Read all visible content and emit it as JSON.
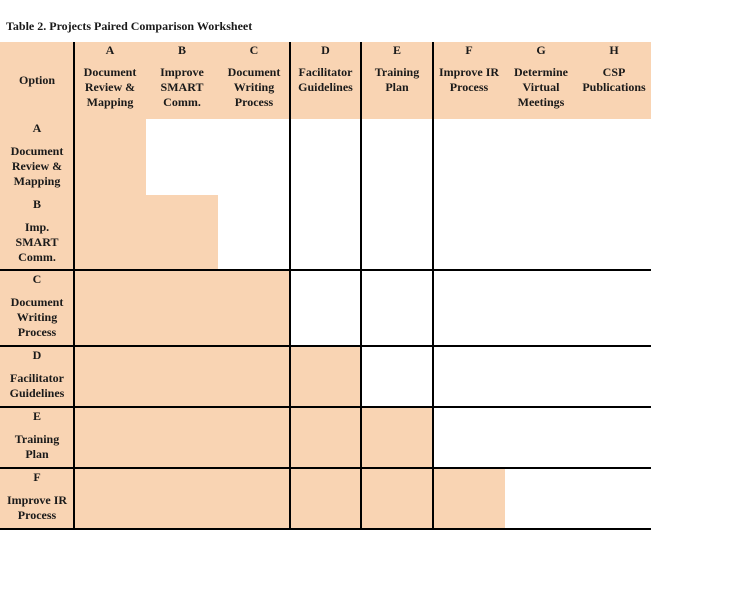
{
  "caption": "Table 2. Projects Paired Comparison Worksheet",
  "colors": {
    "highlight": "#F9D4B3",
    "line": "#000000"
  },
  "header": {
    "option_label": "Option",
    "columns": [
      {
        "letter": "A",
        "name": "Document Review & Mapping",
        "lines": [
          "Document",
          "Review &",
          "Mapping"
        ]
      },
      {
        "letter": "B",
        "name": "Improve SMART Comm.",
        "lines": [
          "Improve",
          "SMART",
          "Comm."
        ]
      },
      {
        "letter": "C",
        "name": "Document Writing Process",
        "lines": [
          "Document",
          "Writing",
          "Process"
        ]
      },
      {
        "letter": "D",
        "name": "Facilitator Guidelines",
        "lines": [
          "Facilitator",
          "Guidelines"
        ]
      },
      {
        "letter": "E",
        "name": "Training Plan",
        "lines": [
          "Training",
          "Plan"
        ]
      },
      {
        "letter": "F",
        "name": "Improve IR Process",
        "lines": [
          "Improve IR",
          "Process"
        ]
      },
      {
        "letter": "G",
        "name": "Determine Virtual Meetings",
        "lines": [
          "Determine",
          "Virtual",
          "Meetings"
        ]
      },
      {
        "letter": "H",
        "name": "CSP Publications",
        "lines": [
          "CSP",
          "Publications"
        ]
      }
    ]
  },
  "rows": [
    {
      "letter": "A",
      "lines": [
        "Document",
        "Review &",
        "Mapping"
      ],
      "shaded_through": 1,
      "cells": [
        "",
        "",
        "",
        "",
        "",
        "",
        "",
        ""
      ]
    },
    {
      "letter": "B",
      "lines": [
        "Imp.",
        "SMART",
        "Comm."
      ],
      "shaded_through": 2,
      "cells": [
        "",
        "",
        "",
        "",
        "",
        "",
        "",
        ""
      ]
    },
    {
      "letter": "C",
      "lines": [
        "Document",
        "Writing",
        "Process"
      ],
      "shaded_through": 3,
      "cells": [
        "",
        "",
        "",
        "",
        "",
        "",
        "",
        ""
      ]
    },
    {
      "letter": "D",
      "lines": [
        "Facilitator",
        "Guidelines"
      ],
      "shaded_through": 4,
      "cells": [
        "",
        "",
        "",
        "",
        "",
        "",
        "",
        ""
      ]
    },
    {
      "letter": "E",
      "lines": [
        "Training",
        "Plan"
      ],
      "shaded_through": 5,
      "cells": [
        "",
        "",
        "",
        "",
        "",
        "",
        "",
        ""
      ]
    },
    {
      "letter": "F",
      "lines": [
        "Improve IR",
        "Process"
      ],
      "shaded_through": 6,
      "cells": [
        "",
        "",
        "",
        "",
        "",
        "",
        "",
        ""
      ]
    }
  ]
}
